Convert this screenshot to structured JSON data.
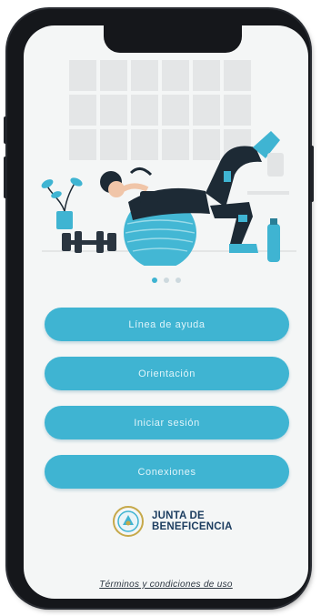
{
  "colors": {
    "accent": "#3fb4d2",
    "phone_frame": "#15171b",
    "screen_bg": "#f4f6f6",
    "logo_text": "#1c3d60"
  },
  "carousel": {
    "page_count": 3,
    "active_index": 0
  },
  "menu": {
    "buttons": [
      {
        "label": "Línea de ayuda"
      },
      {
        "label": "Orientación"
      },
      {
        "label": "Iniciar sesión"
      },
      {
        "label": "Conexiones"
      }
    ]
  },
  "logo": {
    "line1": "JUNTA DE",
    "line2": "BENEFICENCIA"
  },
  "footer": {
    "terms_link": "Términos y condiciones de uso"
  }
}
